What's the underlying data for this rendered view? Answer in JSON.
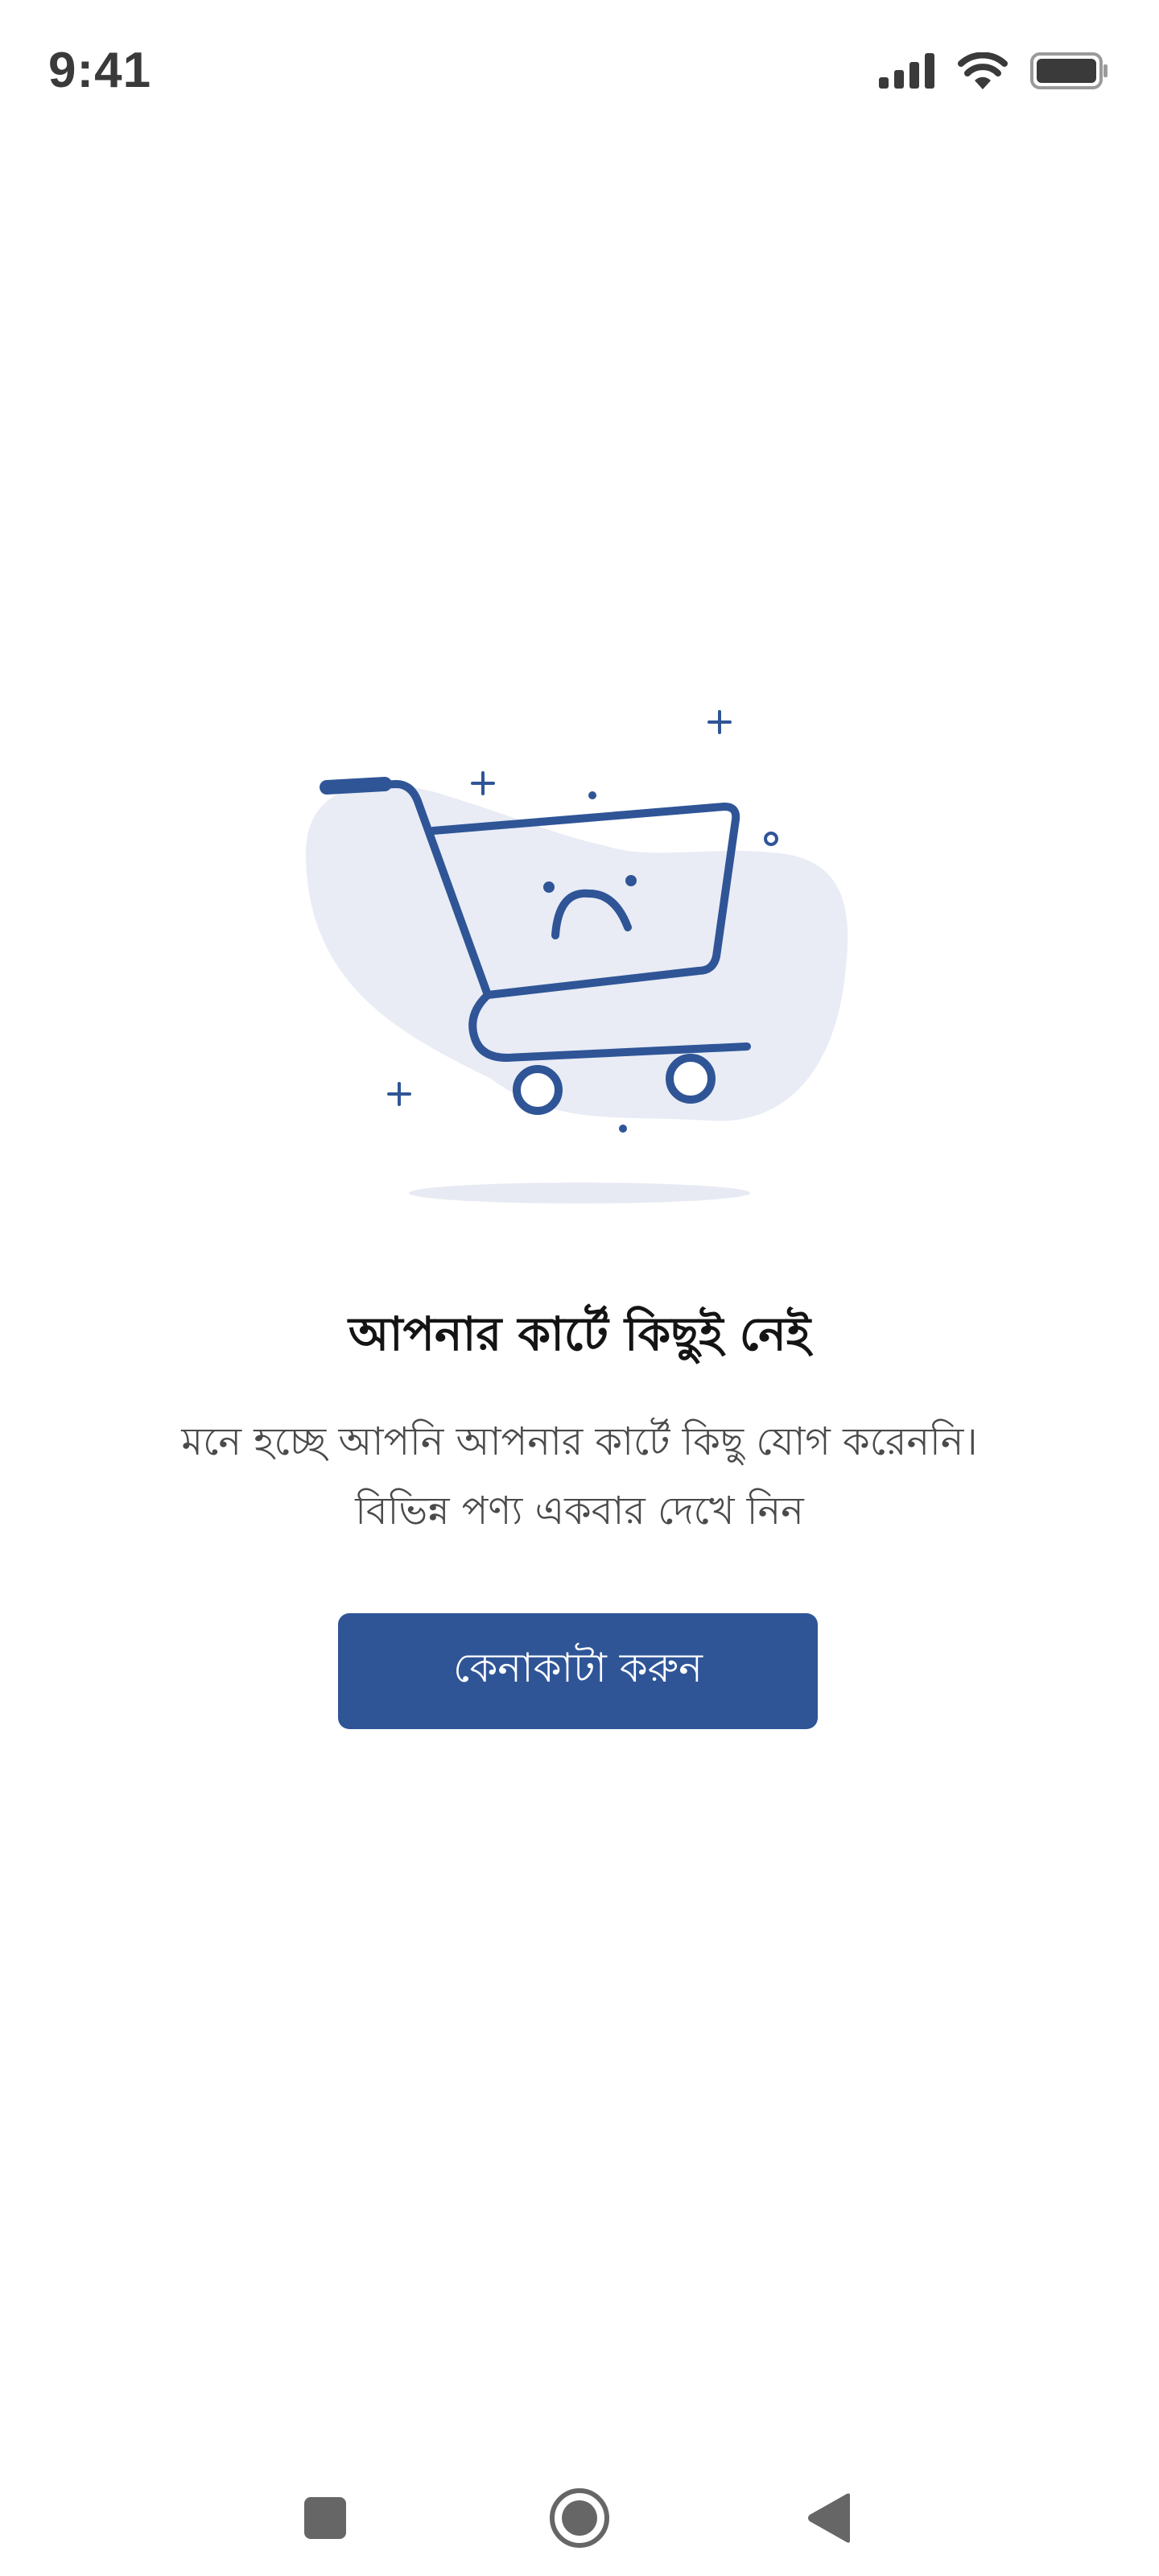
{
  "status_bar": {
    "time": "9:41",
    "icons": [
      "signal-icon",
      "wifi-icon",
      "battery-icon"
    ]
  },
  "empty_cart": {
    "illustration_icon": "sad-shopping-cart-icon",
    "title": "আপনার কার্টে কিছুই নেই",
    "message_line1": "মনে হচ্ছে আপনি আপনার কার্টে কিছু যোগ করেননি।",
    "message_line2": "বিভিন্ন পণ্য একবার দেখে নিন",
    "button_label": "কেনাকাটা করুন"
  },
  "nav_bar": {
    "icons": [
      "recent-apps-icon",
      "home-icon",
      "back-icon"
    ]
  },
  "colors": {
    "accent": "#2f5597",
    "blob": "#e9ecf5",
    "title": "#141414",
    "body": "#4a4a4a",
    "nav_icon": "#666666"
  }
}
